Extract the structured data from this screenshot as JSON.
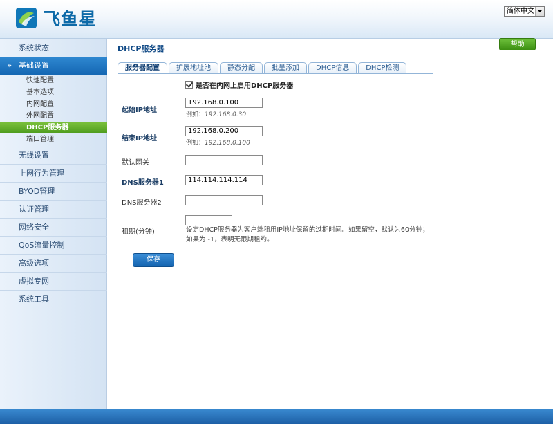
{
  "header": {
    "brand": "飞鱼星",
    "language": "简体中文"
  },
  "sidebar": {
    "items": [
      {
        "label": "系统状态"
      },
      {
        "label": "基础设置"
      },
      {
        "label": "无线设置"
      },
      {
        "label": "上网行为管理"
      },
      {
        "label": "BYOD管理"
      },
      {
        "label": "认证管理"
      },
      {
        "label": "网络安全"
      },
      {
        "label": "QoS流量控制"
      },
      {
        "label": "高级选项"
      },
      {
        "label": "虚拟专网"
      },
      {
        "label": "系统工具"
      }
    ],
    "subitems": [
      {
        "label": "快速配置"
      },
      {
        "label": "基本选项"
      },
      {
        "label": "内网配置"
      },
      {
        "label": "外网配置"
      },
      {
        "label": "DHCP服务器"
      },
      {
        "label": "端口管理"
      }
    ]
  },
  "main": {
    "title": "DHCP服务器",
    "help_label": "帮助",
    "tabs": [
      {
        "label": "服务器配置"
      },
      {
        "label": "扩展地址池"
      },
      {
        "label": "静态分配"
      },
      {
        "label": "批量添加"
      },
      {
        "label": "DHCP信息"
      },
      {
        "label": "DHCP检测"
      }
    ],
    "enable_label": "是否在内网上启用DHCP服务器",
    "fields": {
      "start_ip": {
        "label": "起始IP地址",
        "value": "192.168.0.100",
        "hint_prefix": "例如：",
        "hint_value": "192.168.0.30"
      },
      "end_ip": {
        "label": "结束IP地址",
        "value": "192.168.0.200",
        "hint_prefix": "例如：",
        "hint_value": "192.168.0.100"
      },
      "gateway": {
        "label": "默认网关",
        "value": ""
      },
      "dns1": {
        "label": "DNS服务器1",
        "value": "114.114.114.114"
      },
      "dns2": {
        "label": "DNS服务器2",
        "value": ""
      },
      "lease": {
        "label": "租期(分钟)",
        "value": "",
        "note": "设定DHCP服务器为客户端租用IP地址保留的过期时间。如果留空，默认为60分钟；如果为 -1，表明无限期租约。"
      }
    },
    "save_label": "保存"
  }
}
